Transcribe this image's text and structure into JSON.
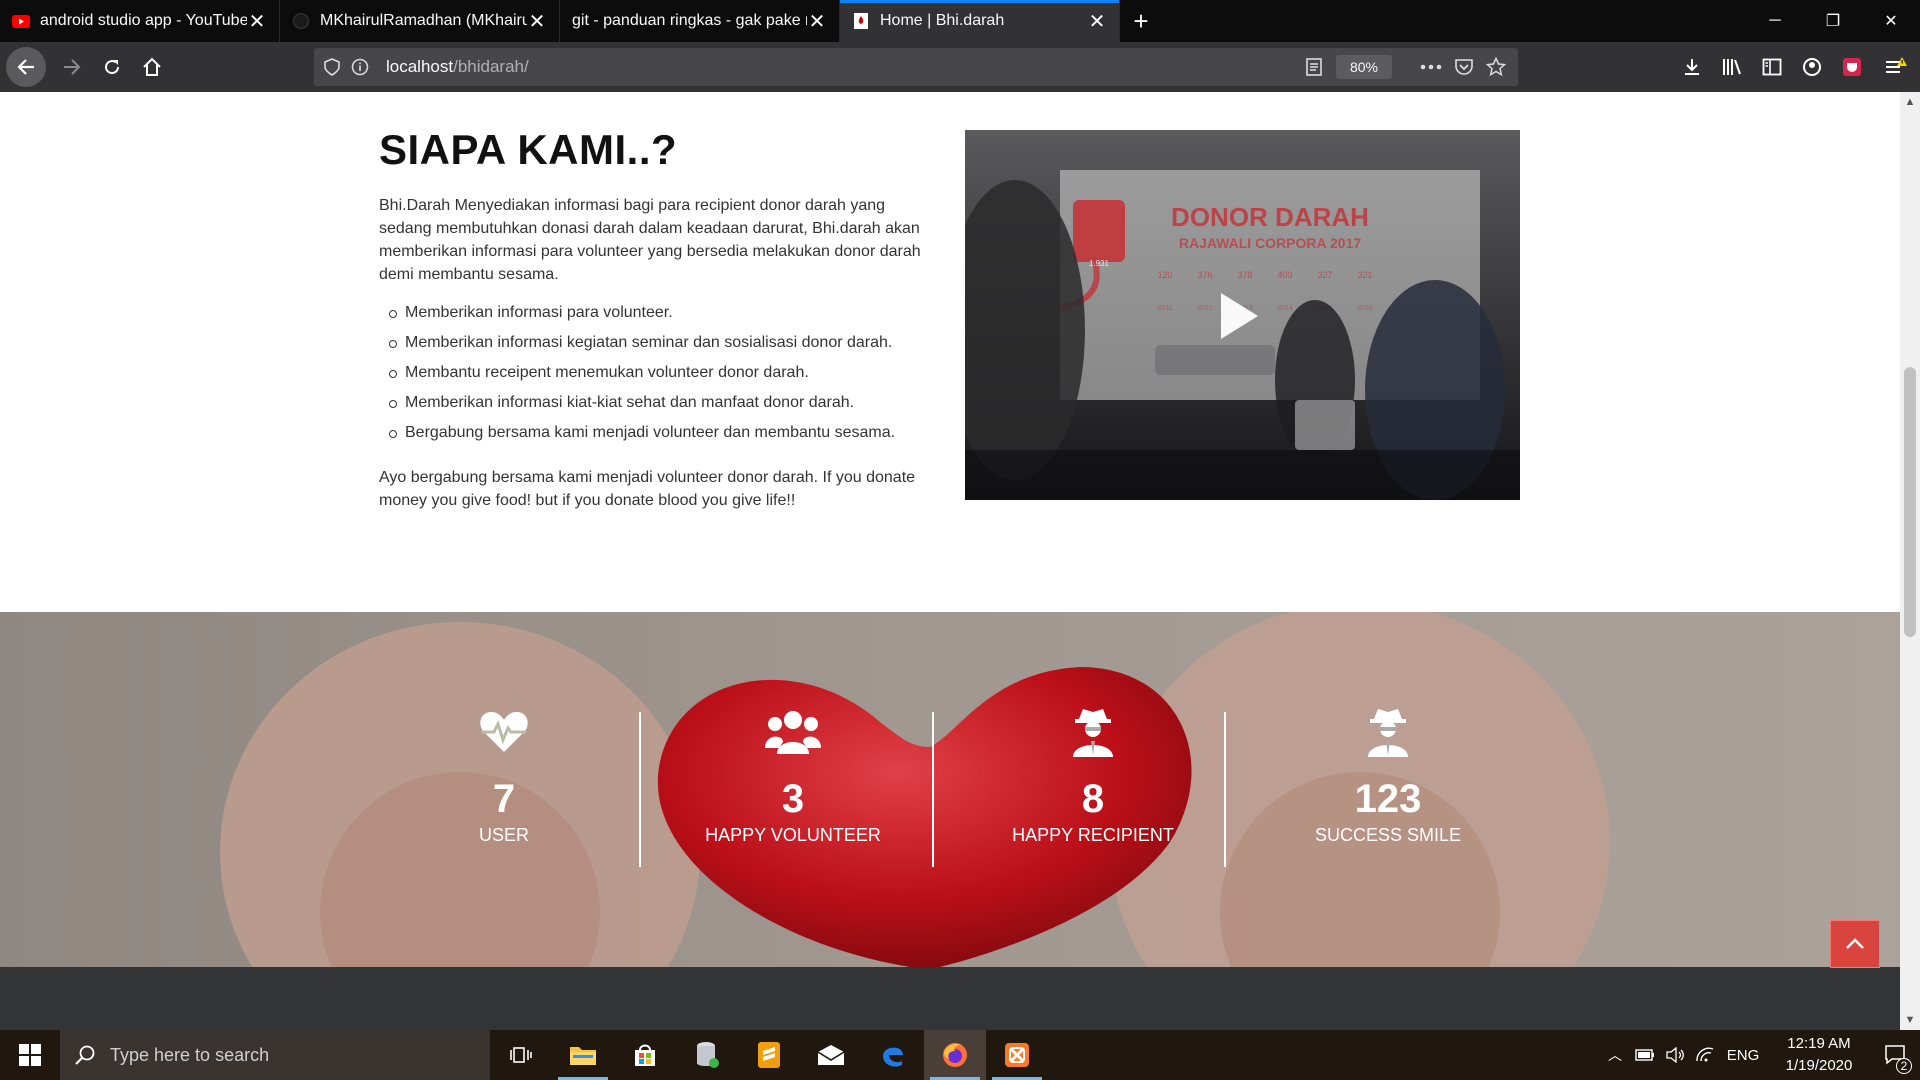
{
  "browser": {
    "tabs": [
      {
        "title": "android studio app - YouTube",
        "active": false
      },
      {
        "title": "MKhairulRamadhan (MKhairulR",
        "active": false
      },
      {
        "title": "git - panduan ringkas - gak pake ri",
        "active": false
      },
      {
        "title": "Home | Bhi.darah",
        "active": true
      }
    ],
    "url_host": "localhost",
    "url_path": "/bhidarah/",
    "zoom": "80%"
  },
  "about": {
    "title": "SIAPA KAMI..?",
    "intro": "Bhi.Darah Menyediakan informasi bagi para recipient donor darah yang sedang membutuhkan donasi darah dalam keadaan darurat, Bhi.darah akan memberikan informasi para volunteer yang bersedia melakukan donor darah demi membantu sesama.",
    "items": [
      "Memberikan informasi para volunteer.",
      "Memberikan informasi kegiatan seminar dan sosialisasi donor darah.",
      "Membantu receipent menemukan volunteer donor darah.",
      "Memberikan informasi kiat-kiat sehat dan manfaat donor darah.",
      "Bergabung bersama kami menjadi volunteer dan membantu sesama."
    ],
    "closing": "Ayo bergabung bersama kami menjadi volunteer donor darah. If you donate money you give food! but if you donate blood you give life!!"
  },
  "video": {
    "banner_title": "DONOR DARAH",
    "banner_subtitle": "RAJAWALI CORPORA 2017",
    "banner_stats": [
      "120",
      "376",
      "378",
      "409",
      "327",
      "321"
    ],
    "banner_years": [
      "2011",
      "2012",
      "2013",
      "2014",
      "2015",
      "2016"
    ],
    "bag_count": "1.931"
  },
  "stats": [
    {
      "value": "7",
      "label": "USER",
      "icon": "heartbeat-icon"
    },
    {
      "value": "3",
      "label": "HAPPY VOLUNTEER",
      "icon": "users-icon"
    },
    {
      "value": "8",
      "label": "HAPPY RECIPIENT",
      "icon": "user-secret-icon"
    },
    {
      "value": "123",
      "label": "SUCCESS SMILE",
      "icon": "user-secret-icon"
    }
  ],
  "taskbar": {
    "search_placeholder": "Type here to search",
    "language": "ENG",
    "time": "12:19 AM",
    "date": "1/19/2020",
    "notifications": "2"
  },
  "colors": {
    "accent_red": "#d9443f",
    "tab_highlight": "#0a84ff",
    "footer": "#333436"
  }
}
